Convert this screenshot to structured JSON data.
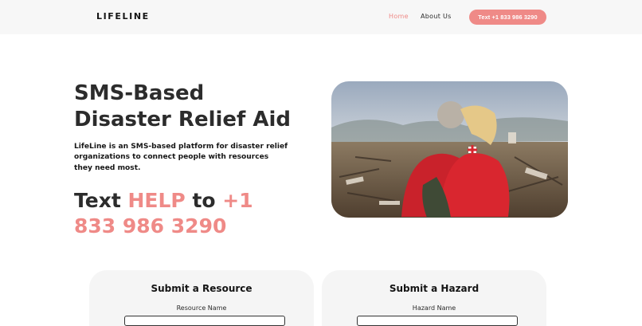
{
  "nav": {
    "logo": "LIFELINE",
    "links": [
      {
        "label": "Home"
      },
      {
        "label": "About Us"
      }
    ],
    "cta_label": "Text +1 833 986 3290"
  },
  "hero": {
    "title": "SMS-Based Disaster Relief Aid",
    "description": "LifeLine is an SMS-based platform for disaster relief organizations to connect people with resources they need most.",
    "cta_prefix": "Text ",
    "cta_keyword": "HELP",
    "cta_middle": " to ",
    "cta_number": "+1 833 986 3290"
  },
  "forms": {
    "resource": {
      "title": "Submit a Resource",
      "field_label": "Resource Name",
      "field_value": ""
    },
    "hazard": {
      "title": "Submit a Hazard",
      "field_label": "Hazard Name",
      "field_value": ""
    }
  },
  "colors": {
    "accent": "#ef8a87",
    "nav_bg": "#f7f7f7",
    "card_bg": "#f5f5f5"
  }
}
